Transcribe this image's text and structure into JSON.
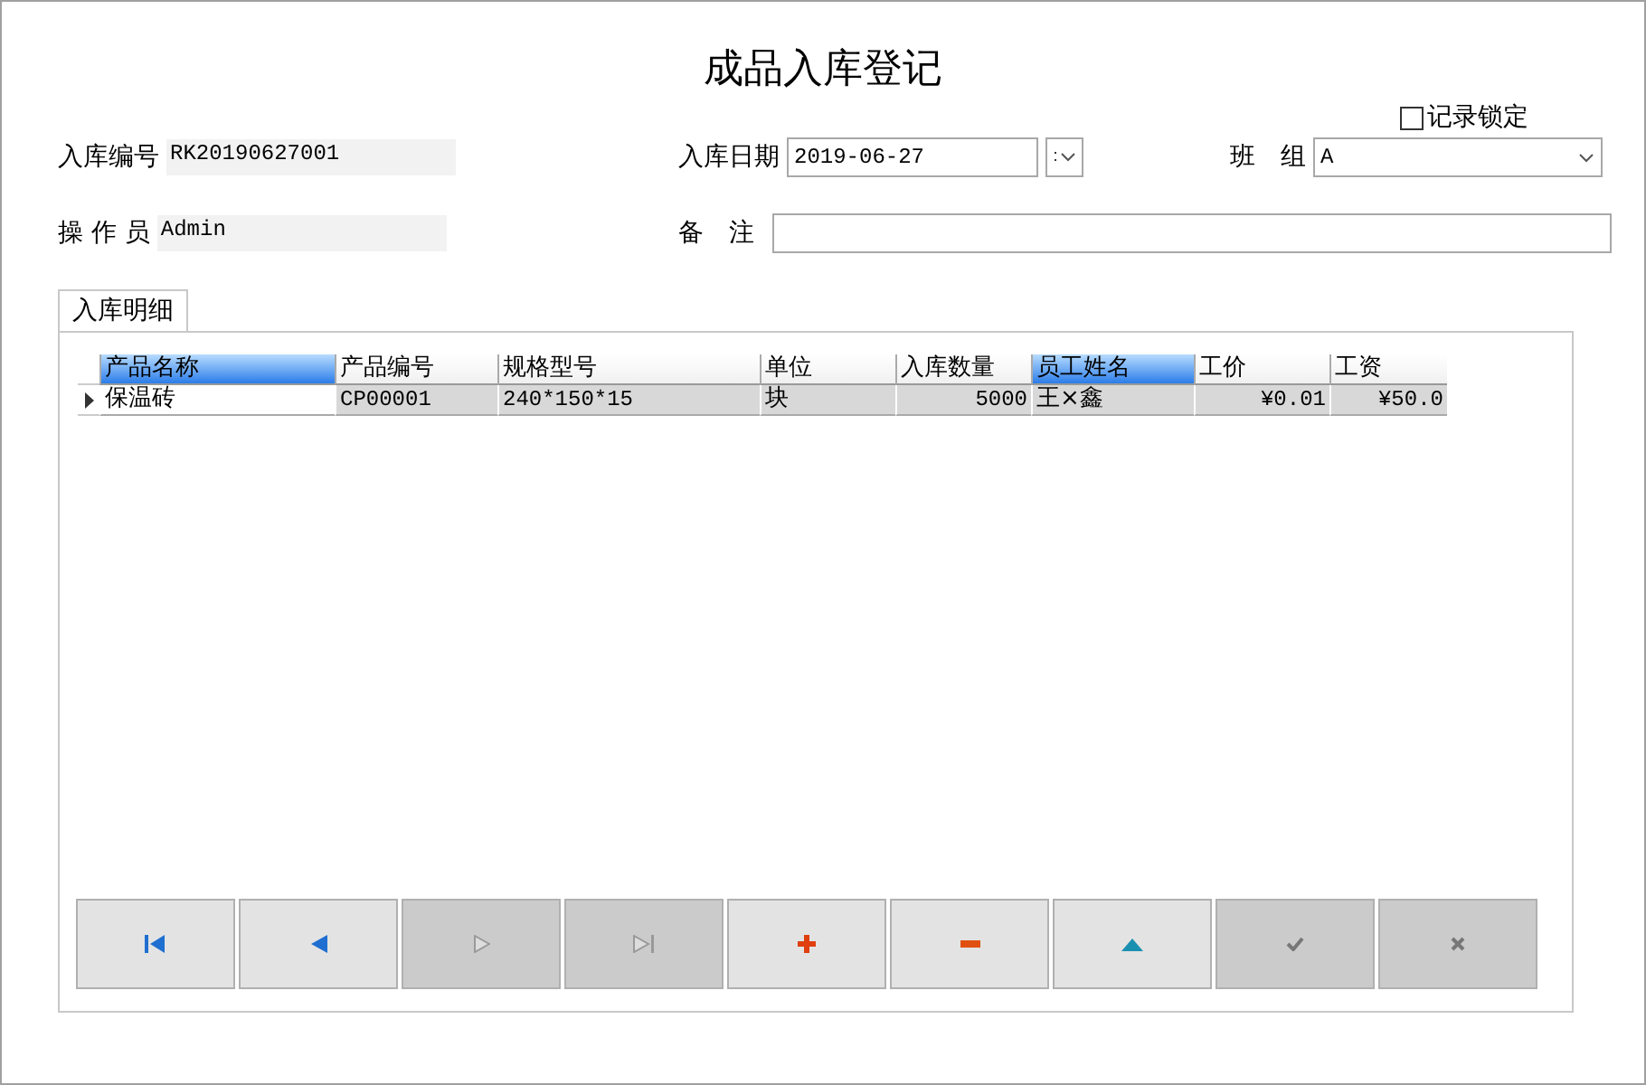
{
  "window": {
    "title": "成品入库登记"
  },
  "record_lock": {
    "label": "记录锁定",
    "checked": false
  },
  "fields": [
    {
      "kind": "readonly",
      "label": "入库编号",
      "value": "RK20190627001"
    },
    {
      "kind": "date",
      "label": "入库日期",
      "value": "2019-06-27"
    },
    {
      "kind": "combo",
      "label": "班　组",
      "value": "A"
    },
    {
      "kind": "readonly",
      "label": "操 作 员",
      "value": "Admin"
    },
    {
      "kind": "text",
      "label": "备　注"
    }
  ],
  "tabs": [
    {
      "label": "入库明细",
      "selected": true
    }
  ],
  "table": {
    "columns": [
      {
        "label": "产品名称",
        "selected": true,
        "kind": "text"
      },
      {
        "label": "产品编号",
        "selected": false,
        "kind": "text"
      },
      {
        "label": "规格型号",
        "selected": false,
        "kind": "text"
      },
      {
        "label": "单位",
        "selected": false,
        "kind": "text"
      },
      {
        "label": "入库数量",
        "selected": false,
        "kind": "number"
      },
      {
        "label": "员工姓名",
        "selected": true,
        "kind": "text"
      },
      {
        "label": "工价",
        "selected": false,
        "kind": "number"
      },
      {
        "label": "工资",
        "selected": false,
        "kind": "number"
      }
    ],
    "rows": [
      {
        "current": true,
        "cells": [
          {
            "text": "保温砖",
            "selected": true
          },
          {
            "text": "CP00001",
            "selected": false
          },
          {
            "text": "240*150*15",
            "selected": false
          },
          {
            "text": "块",
            "selected": false
          },
          {
            "text": "5000",
            "selected": false
          },
          {
            "text": "王×鑫",
            "selected": false
          },
          {
            "text": "¥0.01",
            "selected": false
          },
          {
            "text": "¥50.0",
            "selected": false
          }
        ]
      }
    ]
  },
  "navigator": [
    {
      "kind": "first",
      "disabled": false
    },
    {
      "kind": "prior",
      "disabled": false
    },
    {
      "kind": "next",
      "disabled": true
    },
    {
      "kind": "last",
      "disabled": true
    },
    {
      "kind": "insert",
      "disabled": false
    },
    {
      "kind": "delete",
      "disabled": false
    },
    {
      "kind": "edit",
      "disabled": false
    },
    {
      "kind": "post",
      "disabled": true
    },
    {
      "kind": "cancel",
      "disabled": true
    }
  ]
}
